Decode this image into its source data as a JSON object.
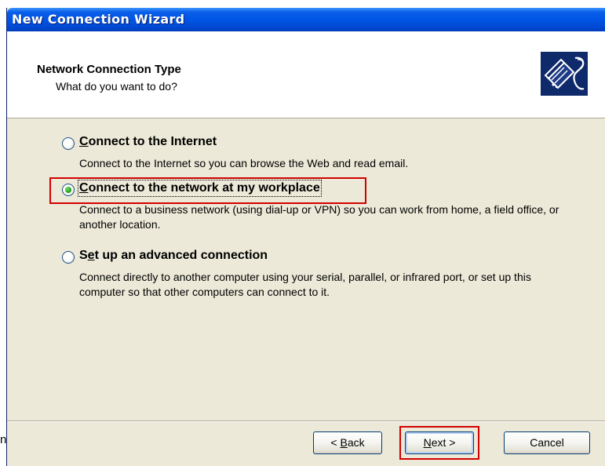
{
  "window": {
    "title": "New Connection Wizard"
  },
  "header": {
    "title": "Network Connection Type",
    "subtitle": "What do you want to do?",
    "icon": "network-cable-icon"
  },
  "options": [
    {
      "label_underlined": "C",
      "label_rest": "onnect to the Internet",
      "description": "Connect to the Internet so you can browse the Web and read email.",
      "selected": false
    },
    {
      "label_underlined": "C",
      "label_rest": "onnect to the network at my workplace",
      "description": "Connect to a business network (using dial-up or VPN) so you can work from home, a field office, or another location.",
      "selected": true
    },
    {
      "label_prefix": "S",
      "label_underlined": "e",
      "label_rest": "t up an advanced connection",
      "description": "Connect directly to another computer using your serial, parallel, or infrared port, or set up this computer so that other computers can connect to it.",
      "selected": false
    }
  ],
  "buttons": {
    "back_prefix": "< ",
    "back_underlined": "B",
    "back_rest": "ack",
    "next_underlined": "N",
    "next_rest": "ext >",
    "cancel": "Cancel"
  },
  "stray_text": "n",
  "colors": {
    "titlebar": "#0055e5",
    "dialog_face": "#ece9d8",
    "highlight_box": "#d20000",
    "radio_dot": "#21a121"
  }
}
